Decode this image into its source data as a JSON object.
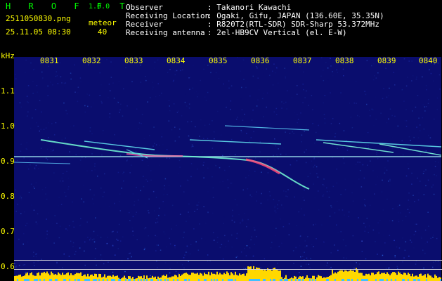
{
  "header": {
    "app_name": "H R O F F T",
    "version": "1.0.0",
    "filename": "2511050830.png",
    "datetime": "25.11.05 08:30",
    "meteor_label": "meteor",
    "meteor_count": "40",
    "info": [
      {
        "label": "Observer",
        "value": ": Takanori Kawachi"
      },
      {
        "label": "Receiving Location",
        "value": ": Ogaki, Gifu, JAPAN (136.60E, 35.35N)"
      },
      {
        "label": "Receiver",
        "value": ": R820T2(RTL-SDR) SDR-Sharp 53.372MHz"
      },
      {
        "label": "Receiving antenna",
        "value": ": 2el-HB9CV Vertical (el. E-W)"
      }
    ]
  },
  "spectrogram": {
    "y_unit": "kHz",
    "x_ticks": [
      "0831",
      "0832",
      "0833",
      "0834",
      "0835",
      "0836",
      "0837",
      "0838",
      "0839",
      "0840"
    ],
    "y_ticks": [
      "1.1",
      "1.0",
      "0.9",
      "0.8",
      "0.7",
      "0.6"
    ],
    "colors": {
      "background": "#0a0d6e",
      "label": "#ffff00",
      "trace": "#3fe0e8",
      "hot": "#ff3a8a",
      "baseline": "#ffd800"
    }
  }
}
